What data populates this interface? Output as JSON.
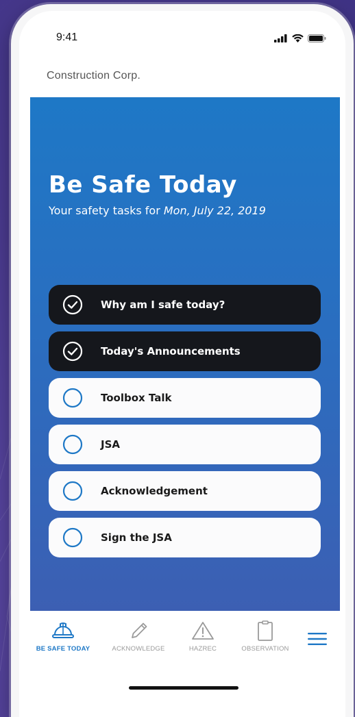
{
  "status_bar": {
    "time": "9:41"
  },
  "company": "Construction Corp.",
  "hero": {
    "title": "Be Safe Today",
    "subtitle_prefix": "Your safety tasks for ",
    "subtitle_date": "Mon, July 22, 2019"
  },
  "tasks": [
    {
      "label": "Why am I safe today?",
      "done": true
    },
    {
      "label": "Today's Announcements",
      "done": true
    },
    {
      "label": "Toolbox Talk",
      "done": false
    },
    {
      "label": "JSA",
      "done": false
    },
    {
      "label": "Acknowledgement",
      "done": false
    },
    {
      "label": "Sign the JSA",
      "done": false
    }
  ],
  "tabbar": {
    "tabs": [
      {
        "label": "BE SAFE TODAY",
        "icon": "hard-hat-icon",
        "active": true
      },
      {
        "label": "ACKNOWLEDGE",
        "icon": "pencil-icon",
        "active": false
      },
      {
        "label": "HAZREC",
        "icon": "warning-icon",
        "active": false
      },
      {
        "label": "OBSERVATION",
        "icon": "clipboard-icon",
        "active": false
      }
    ]
  },
  "colors": {
    "accent": "#1e78c6",
    "done_task_bg": "#15171c",
    "todo_task_bg": "#fbfbfc",
    "background": "#4a3a8e"
  }
}
